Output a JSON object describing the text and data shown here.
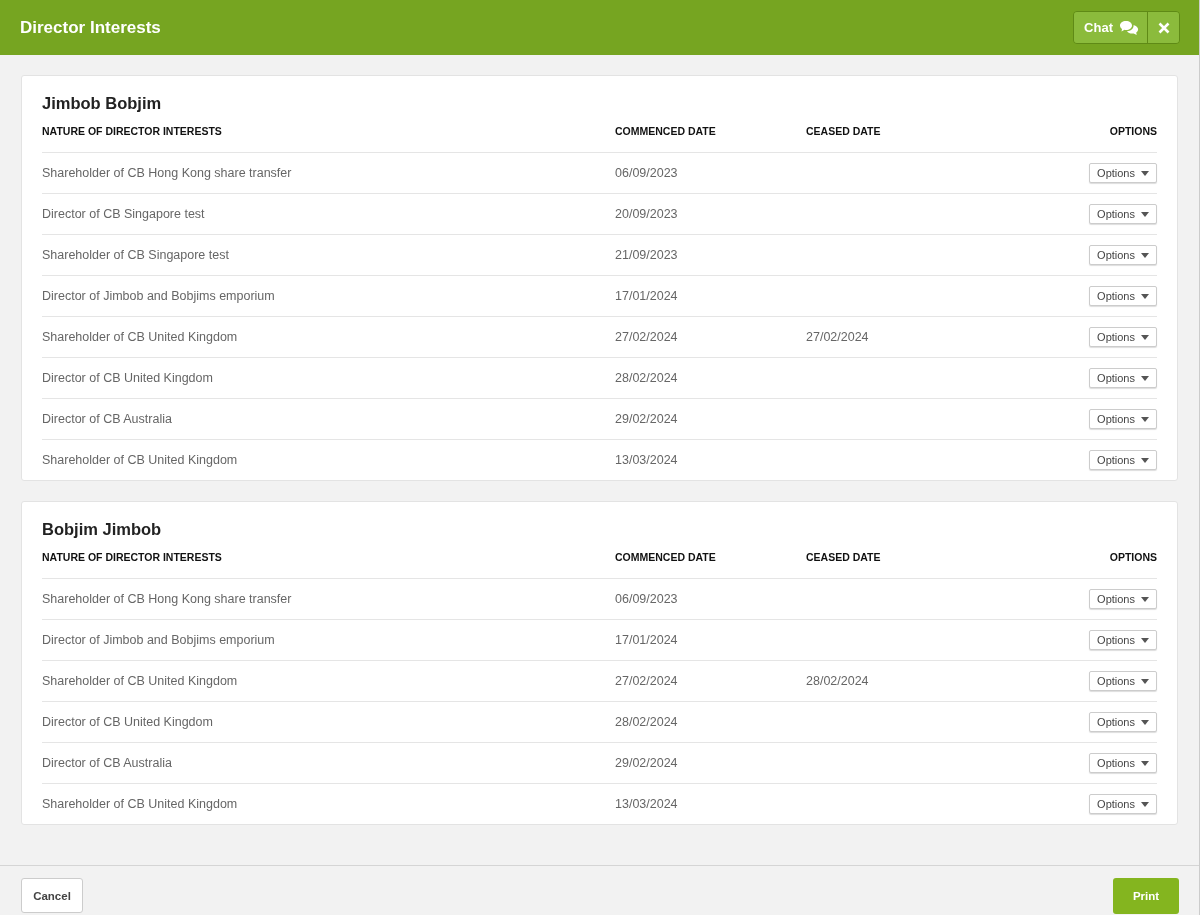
{
  "window": {
    "title": "Director Interests"
  },
  "header_buttons": {
    "chat": "Chat"
  },
  "directors": [
    {
      "name": "Jimbob Bobjim",
      "columns": [
        "NATURE OF DIRECTOR INTERESTS",
        "COMMENCED DATE",
        "CEASED DATE",
        "OPTIONS"
      ],
      "rows": [
        {
          "nature": "Shareholder of CB Hong Kong share transfer",
          "commenced": "06/09/2023",
          "ceased": "",
          "options": "Options"
        },
        {
          "nature": "Director of CB Singapore test",
          "commenced": "20/09/2023",
          "ceased": "",
          "options": "Options"
        },
        {
          "nature": "Shareholder of CB Singapore test",
          "commenced": "21/09/2023",
          "ceased": "",
          "options": "Options"
        },
        {
          "nature": "Director of Jimbob and Bobjims emporium",
          "commenced": "17/01/2024",
          "ceased": "",
          "options": "Options"
        },
        {
          "nature": "Shareholder of CB United Kingdom",
          "commenced": "27/02/2024",
          "ceased": "27/02/2024",
          "options": "Options"
        },
        {
          "nature": "Director of CB United Kingdom",
          "commenced": "28/02/2024",
          "ceased": "",
          "options": "Options"
        },
        {
          "nature": "Director of CB Australia",
          "commenced": "29/02/2024",
          "ceased": "",
          "options": "Options"
        },
        {
          "nature": "Shareholder of CB United Kingdom",
          "commenced": "13/03/2024",
          "ceased": "",
          "options": "Options"
        }
      ]
    },
    {
      "name": "Bobjim Jimbob",
      "columns": [
        "NATURE OF DIRECTOR INTERESTS",
        "COMMENCED DATE",
        "CEASED DATE",
        "OPTIONS"
      ],
      "rows": [
        {
          "nature": "Shareholder of CB Hong Kong share transfer",
          "commenced": "06/09/2023",
          "ceased": "",
          "options": "Options"
        },
        {
          "nature": "Director of Jimbob and Bobjims emporium",
          "commenced": "17/01/2024",
          "ceased": "",
          "options": "Options"
        },
        {
          "nature": "Shareholder of CB United Kingdom",
          "commenced": "27/02/2024",
          "ceased": "28/02/2024",
          "options": "Options"
        },
        {
          "nature": "Director of CB United Kingdom",
          "commenced": "28/02/2024",
          "ceased": "",
          "options": "Options"
        },
        {
          "nature": "Director of CB Australia",
          "commenced": "29/02/2024",
          "ceased": "",
          "options": "Options"
        },
        {
          "nature": "Shareholder of CB United Kingdom",
          "commenced": "13/03/2024",
          "ceased": "",
          "options": "Options"
        }
      ]
    }
  ],
  "footer": {
    "cancel": "Cancel",
    "print": "Print"
  }
}
